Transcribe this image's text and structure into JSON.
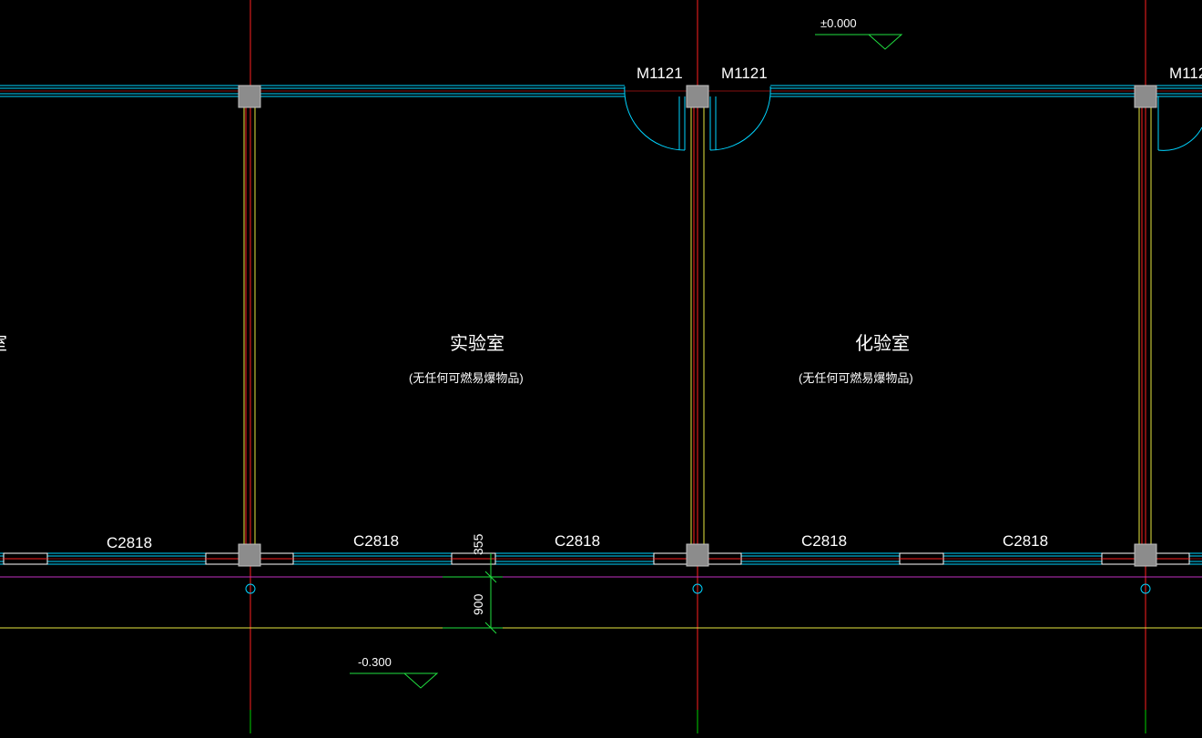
{
  "colors": {
    "background": "#000000",
    "wall_line": "#00d4ff",
    "axis_red": "#ff2020",
    "axis_green": "#00d000",
    "inner_yellow": "#e8e840",
    "purple": "#c030c0",
    "column": "#8c8c8c",
    "dim_green": "#20e040",
    "text": "#ffffff"
  },
  "elevation_top": "±0.000",
  "elevation_bottom": "-0.300",
  "doors": [
    "M1121",
    "M1121",
    "M112"
  ],
  "windows": [
    "C2818",
    "C2818",
    "C2818",
    "C2818",
    "C2818"
  ],
  "rooms": [
    {
      "name": "实验室",
      "note": "(无任何可燃易爆物品)"
    },
    {
      "name": "化验室",
      "note": "(无任何可燃易爆物品)"
    }
  ],
  "cut_label": "室",
  "dimensions": {
    "upper": "355",
    "lower": "900"
  },
  "icons": {
    "elevation_marker": "triangle-elevation-icon",
    "axis_bubble": "axis-circle-icon",
    "column": "column-square-icon"
  }
}
